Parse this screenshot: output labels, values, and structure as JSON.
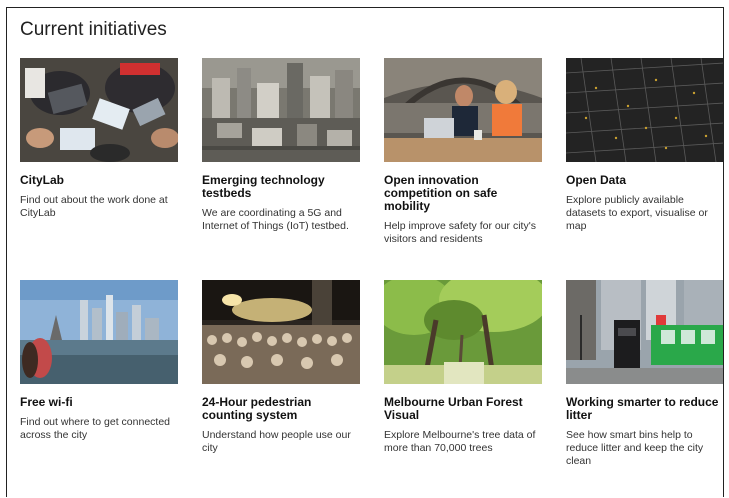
{
  "section": {
    "title": "Current initiatives"
  },
  "cards": [
    {
      "title": "CityLab",
      "desc": "Find out about the work done at CityLab",
      "image": "people-at-laptops-photo"
    },
    {
      "title": "Emerging technology testbeds",
      "desc": "We are coordinating a 5G and Internet of Things (IoT) testbed.",
      "image": "aerial-city-photo"
    },
    {
      "title": "Open innovation competition on safe mobility",
      "desc": "Help improve safety for our city's visitors and residents",
      "image": "cafe-colleagues-photo"
    },
    {
      "title": "Open Data",
      "desc": "Explore publicly available datasets to export, visualise or map",
      "image": "street-map-graphic"
    },
    {
      "title": "Free wi-fi",
      "desc": "Find out where to get connected across the city",
      "image": "city-skyline-photo"
    },
    {
      "title": "24-Hour pedestrian counting system",
      "desc": "Understand how people use our city",
      "image": "night-crowd-photo"
    },
    {
      "title": "Melbourne Urban Forest Visual",
      "desc": "Explore Melbourne's tree data of more than 70,000 trees",
      "image": "tree-avenue-photo"
    },
    {
      "title": "Working smarter to reduce litter",
      "desc": "See how smart bins help to reduce litter and keep the city clean",
      "image": "smart-bin-tram-photo"
    }
  ],
  "colors": {
    "title_text": "#222222",
    "frame_border": "#222222"
  }
}
